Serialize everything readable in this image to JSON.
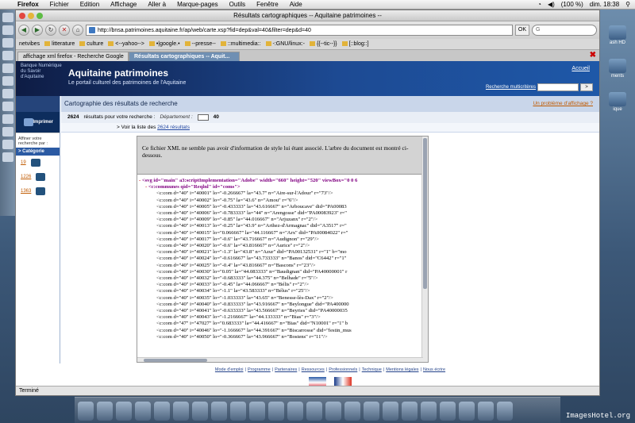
{
  "menubar": {
    "app": "Firefox",
    "items": [
      "Fichier",
      "Edition",
      "Affichage",
      "Aller à",
      "Marque-pages",
      "Outils",
      "Fenêtre",
      "Aide"
    ],
    "battery": "(100 %)",
    "clock": "dim. 18:38"
  },
  "window": {
    "title": "Résultats cartographiques -- Aquitaine patrimoines --"
  },
  "navbar": {
    "url": "http://bnsa.patrimoines.aquitaine.fr/ap/web/carte.xsp?fid=dep&val=40&filter=dep&d=40",
    "ok": "OK"
  },
  "bookmarks": [
    "netvibes",
    "litterature",
    "culture",
    "<--yahoo-->",
    "•|google.•",
    "--presse--",
    "::multimedia::",
    "-:GNU/linux:-",
    "{{--tic--}}",
    "[::blog::]"
  ],
  "tabs": [
    {
      "label": "affichage xml firefox - Recherche Google"
    },
    {
      "label": "Résultats cartographiques -- Aquit..."
    }
  ],
  "site": {
    "org": "Banque Numérique du Savoir d'Aquitaine",
    "brand": "Aquitaine patrimoines",
    "tagline": "Le portail culturel des patrimoines de l'Aquitaine",
    "accueil": "Accueil",
    "recherche": "Recherche multicritères",
    "go": ">"
  },
  "left": {
    "imprimer": "Imprimer",
    "affiner": "Affiner votre recherche par :",
    "categorie": "> Catégorie",
    "links": [
      "19",
      "1226",
      "1363"
    ]
  },
  "main": {
    "title": "Cartographie des résultats de recherche",
    "problem": "Un problème d'affichage ?",
    "count": "2624",
    "count_text": "résultats pour votre recherche :",
    "dep_label": "Département :",
    "dep_value": "40",
    "voir_prefix": "> Voir la liste des",
    "voir_link": "2624 résultats"
  },
  "xml": {
    "note": "Ce fichier XML ne semble pas avoir d'information de style lui étant associé. L'arbre du document est montré ci-dessous.",
    "svg_line": "<svg id=\"main\" a3:scriptImplementation=\"Adobe\" width=\"660\" height=\"520\" viewBox=\"0 0 6",
    "communes_line": "<c:communes qid=\"Reqlnl\" id=\"coms\">",
    "rows": [
      "<c:com d=\"40\" i=\"40001\" lo=\"-0.266667\" la=\"43.7\" n=\"Aire-sur-l'Adour\" r=\"73\"/>",
      "<c:com d=\"40\" i=\"40002\" lo=\"-0.75\" la=\"43.6\" n=\"Amou\" r=\"6\"/>",
      "<c:com d=\"40\" i=\"40005\" lo=\"-0.433333\" la=\"43.616667\" n=\"Arboucave\" did=\"PA00083",
      "<c:com d=\"40\" i=\"40006\" lo=\"-0.783333\" la=\"44\" n=\"Arengosse\" did=\"PA00083923\" r=\"",
      "<c:com d=\"40\" i=\"40009\" lo=\"-0.85\" la=\"44.016667\" n=\"Arjuzanx\" r=\"2\"/>",
      "<c:com d=\"40\" i=\"40013\" lo=\"-0.25\" la=\"43.9\" n=\"Arthez-d'Armagnac\" did=\"A3517\" r=\"",
      "<c:com d=\"40\" i=\"40015\" lo=\"0.066667\" la=\"44.116667\" n=\"Arx\" did=\"PA00084022\" r=\"",
      "<c:com d=\"40\" i=\"40017\" lo=\"-0.6\" la=\"43.716667\" n=\"Audignon\" r=\"29\"/>",
      "<c:com d=\"40\" i=\"40020\" lo=\"-0.6\" la=\"43.816667\" n=\"Aurice\" r=\"2\"/>",
      "<c:com d=\"40\" i=\"40021\" lo=\"-1.3\" la=\"43.8\" n=\"Azur\" did=\"PA00132531\" r=\"1\" b=\"mo",
      "<c:com d=\"40\" i=\"40024\" lo=\"-0.616667\" la=\"43.733333\" n=\"Banos\" did=\"C6442\" r=\"1\"",
      "<c:com d=\"40\" i=\"40025\" lo=\"-0.4\" la=\"43.816667\" n=\"Bascons\" r=\"23\"/>",
      "<c:com d=\"40\" i=\"40030\" lo=\"0.05\" la=\"44.083333\" n=\"Baudignan\" did=\"PA40000001\" r",
      "<c:com d=\"40\" i=\"40032\" lo=\"-0.683333\" la=\"44.375\" n=\"Belhade\" r=\"5\"/>",
      "<c:com d=\"40\" i=\"40033\" lo=\"-0.45\" la=\"44.066667\" n=\"Bélis\" r=\"2\"/>",
      "<c:com d=\"40\" i=\"40034\" lo=\"-1.1\" la=\"43.583333\" n=\"Bélus\" r=\"25\"/>",
      "<c:com d=\"40\" i=\"40035\" lo=\"-1.033333\" la=\"43.65\" n=\"Benesse-lès-Dax\" r=\"2\"/>",
      "<c:com d=\"40\" i=\"40040\" lo=\"-0.833333\" la=\"43.916667\" n=\"Beylongue\" did=\"PA400000",
      "<c:com d=\"40\" i=\"40041\" lo=\"-0.633333\" la=\"43.566667\" n=\"Beyries\" did=\"PA40000035",
      "<c:com d=\"40\" i=\"40043\" lo=\"-1.2166667\" la=\"44.133333\" n=\"Bias\" r=\"3\"/>",
      "<c:com d=\"47\" i=\"47027\" lo=\"0.683333\" la=\"44.416667\" n=\"Bias\" did=\"N10001\" r=\"1\" b",
      "<c:com d=\"40\" i=\"40046\" lo=\"-1.166667\" la=\"44.391667\" n=\"Biscarrosse\" did=\"festin_mus",
      "<c:com d=\"40\" i=\"40050\" lo=\"-0.366667\" la=\"43.966667\" n=\"Bostens\" r=\"11\"/>"
    ]
  },
  "footer": {
    "links": [
      "Mode d'emploi",
      "Programme",
      "Partenaires",
      "Ressources",
      "Professionnels",
      "Technique",
      "Mentions légales",
      "Nous écrire"
    ]
  },
  "status": "Terminé",
  "desktop": {
    "icons": [
      "ash HD",
      "ments",
      "ique"
    ],
    "watermark": "ImagesHotel.org"
  }
}
